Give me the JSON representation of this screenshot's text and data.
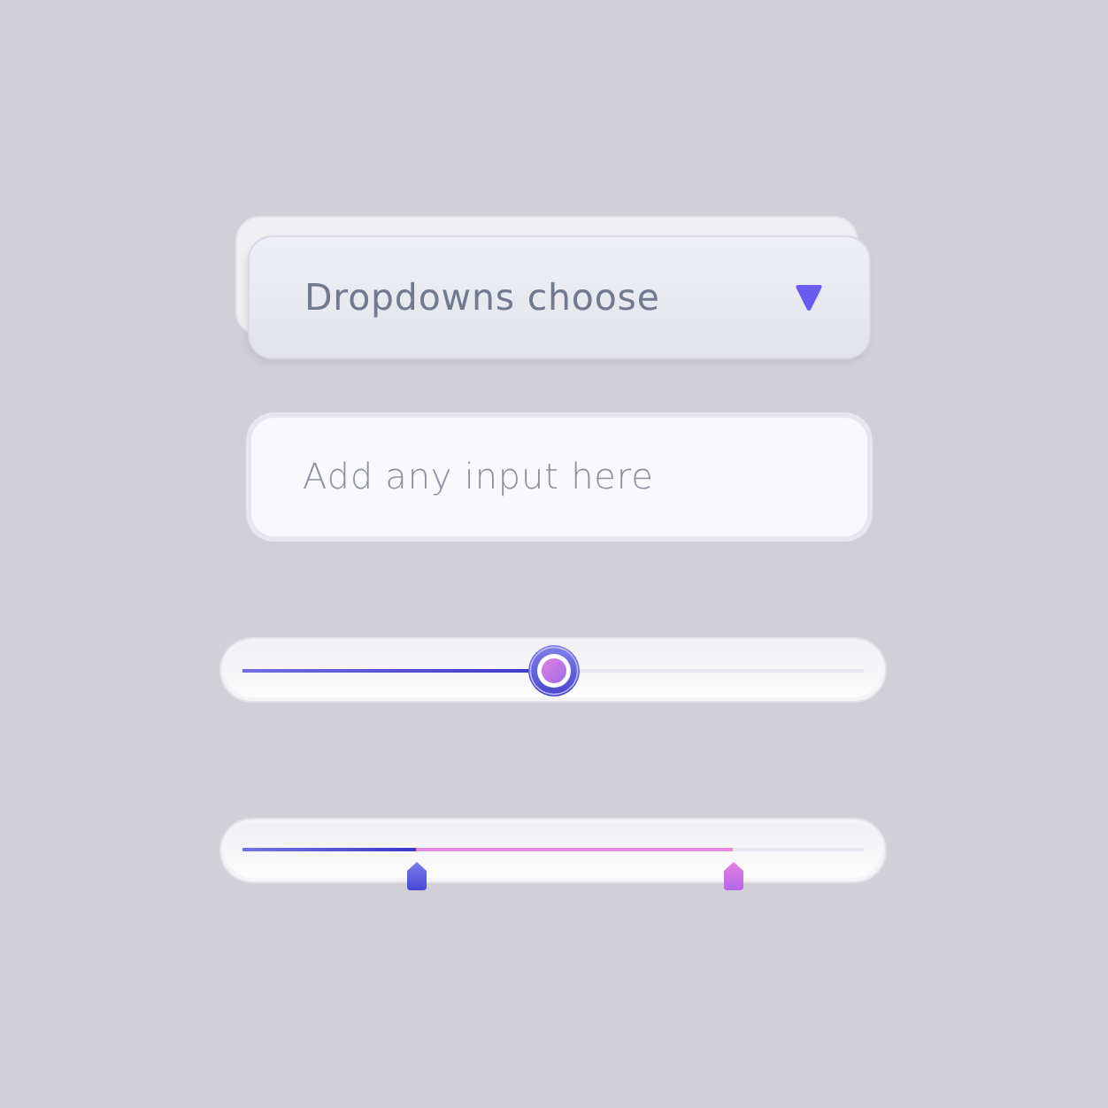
{
  "dropdown": {
    "label": "Dropdowns choose"
  },
  "input": {
    "placeholder": "Add any input here"
  },
  "slider": {
    "level": 0.5
  },
  "range_slider": {
    "thumbs": [
      {
        "level": 0.28
      },
      {
        "level": 0.79
      }
    ]
  }
}
